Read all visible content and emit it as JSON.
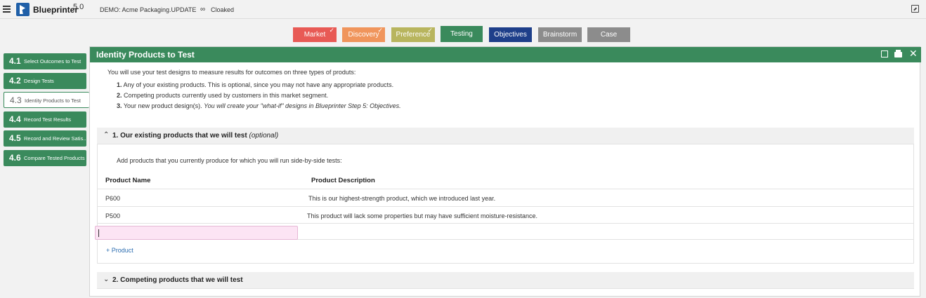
{
  "app": {
    "brand": "Blueprinter",
    "version": "5.0",
    "demo_label": "DEMO: Acme Packaging.UPDATE",
    "cloak_label": "Cloaked"
  },
  "steps": [
    {
      "label": "Market",
      "checked": true,
      "color": "#e85a55"
    },
    {
      "label": "Discovery",
      "checked": true,
      "color": "#f0955c"
    },
    {
      "label": "Preference",
      "checked": true,
      "color": "#b8b55e"
    },
    {
      "label": "Testing",
      "checked": false,
      "color": "#3a8a5c"
    },
    {
      "label": "Objectives",
      "checked": false,
      "color": "#1e3f8a"
    },
    {
      "label": "Brainstorm",
      "checked": false,
      "color": "#8c8c8c"
    },
    {
      "label": "Case",
      "checked": false,
      "color": "#8c8c8c"
    }
  ],
  "sidebar": {
    "items": [
      {
        "num": "4.1",
        "label": "Select Outcomes to Test"
      },
      {
        "num": "4.2",
        "label": "Design Tests"
      },
      {
        "num": "4.3",
        "label": "Identity Products to Test"
      },
      {
        "num": "4.4",
        "label": "Record Test Results"
      },
      {
        "num": "4.5",
        "label": "Record and Review Satis..."
      },
      {
        "num": "4.6",
        "label": "Compare Tested Products"
      }
    ]
  },
  "panel": {
    "title": "Identity Products to Test",
    "intro": "You will use your test designs to measure results for outcomes on three types of produts:",
    "list": [
      {
        "num": "1.",
        "text": "Any of your existing products. This is optional, since you may not have any appropriate products.",
        "italic": ""
      },
      {
        "num": "2.",
        "text": "Competing products currently used by customers in this market segment.",
        "italic": ""
      },
      {
        "num": "3.",
        "text": "Your new product design(s). ",
        "italic": "You will create your \"what-if\" designs in Blueprinter Step 5: Objectives."
      }
    ],
    "section1": {
      "title": "1. Our existing products that we will test",
      "optional": "(optional)",
      "description": "Add products that you currently produce for which you will run side-by-side tests:",
      "columns": {
        "name": "Product Name",
        "description": "Product Description"
      },
      "rows": [
        {
          "name": "P600",
          "description": "This is our highest-strength product, which we introduced last year."
        },
        {
          "name": "P500",
          "description": "This product will lack some properties but may have sufficient moisture-resistance."
        }
      ],
      "new_product_value": "",
      "add_label": "+ Product"
    },
    "section2": {
      "title": "2. Competing products that we will test"
    }
  }
}
